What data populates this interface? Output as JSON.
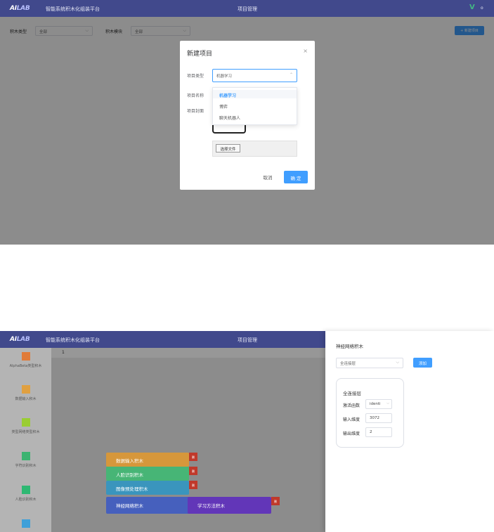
{
  "top": {
    "header": {
      "brand": "AI",
      "brand_lab": "LAB",
      "app_title": "智能系统积木化组装平台",
      "center_title": "项目管理",
      "corner_letter": "V",
      "corner_dot": "o"
    },
    "filters": {
      "type_label": "积木类型",
      "type_value": "全部",
      "category_label": "积木模块",
      "category_value": "全部"
    },
    "new_project_button": "+ 新建项目",
    "modal": {
      "title": "新建项目",
      "close": "×",
      "project_type_label": "项目类型",
      "project_type_value": "机器学习",
      "project_name_label": "项目名称",
      "project_cover_label": "项目封面",
      "dropdown_options": [
        "机器学习",
        "博弈",
        "聊天机器人"
      ],
      "choose_file_button": "选择文件",
      "cancel_button": "取消",
      "confirm_button": "确 定"
    }
  },
  "bottom": {
    "header": {
      "brand": "AI",
      "brand_lab": "LAB",
      "app_title": "智能系统积木化组装平台",
      "center_title": "项目管理"
    },
    "tab_number": "1",
    "sidebar": [
      {
        "label": "AlphaBeta类型积木",
        "color": "#e07b39"
      },
      {
        "label": "数据输入积木",
        "color": "#e0a040"
      },
      {
        "label": "类型网络类型积木",
        "color": "#9acd32"
      },
      {
        "label": "字符识别积木",
        "color": "#3cb371"
      },
      {
        "label": "人脸识别积木",
        "color": "#2eb872"
      },
      {
        "label": "",
        "color": "#3fa0d8"
      }
    ],
    "blocks": [
      {
        "label": "数据输入积木",
        "color": "#e0a040"
      },
      {
        "label": "人脸识别积木",
        "color": "#4cc07a"
      },
      {
        "label": "图像预处理积木",
        "color": "#3a9fc8"
      },
      {
        "label": "神经网络积木",
        "color": "#4a62c4"
      },
      {
        "label": "学习方法积木",
        "color": "#6a3fc2"
      }
    ],
    "delete_icon_text": "删",
    "panel": {
      "title": "神经网络积木",
      "layer_select": "全连接层",
      "add_button": "添加",
      "group_title": "全连接层",
      "activation_label": "激活函数",
      "activation_value": "identi",
      "input_dim_label": "输入维度",
      "input_dim_value": "3072",
      "output_dim_label": "输出维度",
      "output_dim_value": "2"
    }
  }
}
